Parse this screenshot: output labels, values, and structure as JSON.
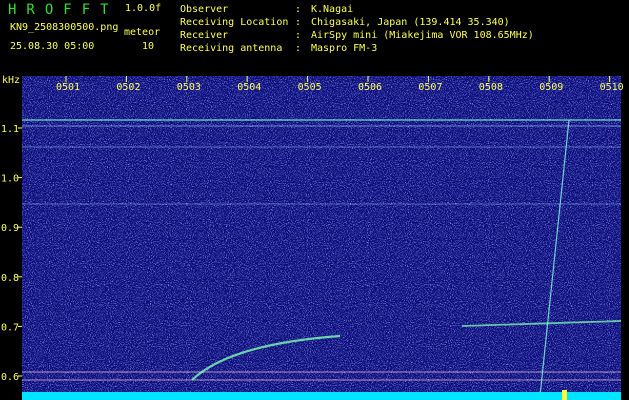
{
  "header": {
    "title": "HROFFT",
    "version": "1.0.0f",
    "filename": "KN9_2508300500.png",
    "meteor_label": "meteor",
    "datetime": "25.08.30 05:00",
    "meteor_count": "10"
  },
  "info": [
    {
      "key": "Observer",
      "sep": ":",
      "value": "K.Nagai"
    },
    {
      "key": "Receiving Location",
      "sep": ":",
      "value": "Chigasaki, Japan (139.414 35.340)"
    },
    {
      "key": "Receiver",
      "sep": ":",
      "value": "AirSpy mini (Miakejima VOR 108.65MHz)"
    },
    {
      "key": "Receiving antenna",
      "sep": ":",
      "value": "Maspro FM-3"
    }
  ],
  "axes": {
    "y_unit": "kHz",
    "y_ticks": [
      "1.1",
      "1.0",
      "0.9",
      "0.8",
      "0.7",
      "0.6"
    ],
    "x_ticks": [
      "0501",
      "0502",
      "0503",
      "0504",
      "0505",
      "0506",
      "0507",
      "0508",
      "0509",
      "0510"
    ]
  },
  "colors": {
    "background": "#000000",
    "header_text": "#ffff55",
    "title_green": "#33dd33",
    "spectrogram_bg": "#0a0a7a",
    "signal": "#88ffdd",
    "floor": "#00e5ff"
  }
}
